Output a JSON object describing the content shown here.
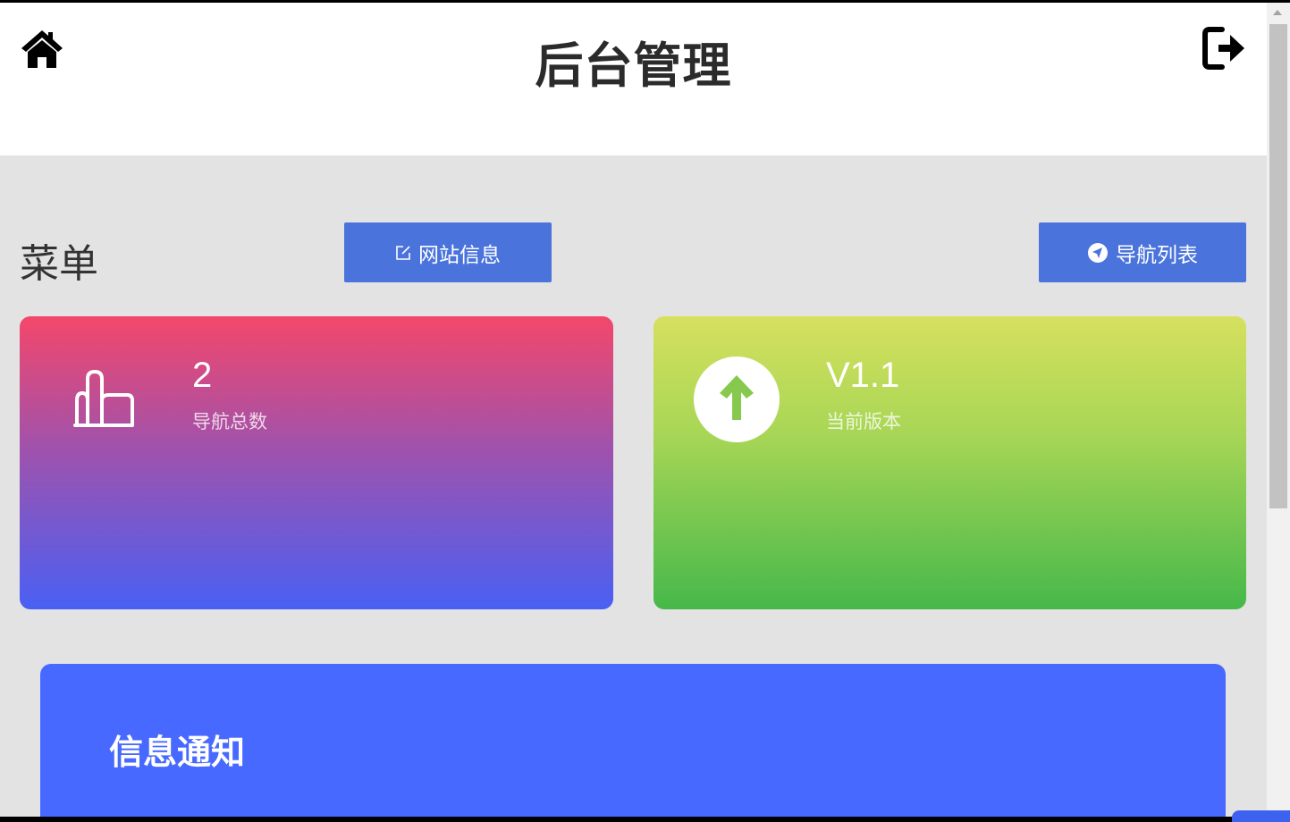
{
  "header": {
    "title": "后台管理",
    "home_icon": "home-icon",
    "logout_icon": "logout-icon"
  },
  "menu": {
    "title": "菜单",
    "site_info_button": "网站信息",
    "site_info_icon": "edit-icon",
    "nav_list_button": "导航列表",
    "nav_list_icon": "location-arrow-icon"
  },
  "stats": {
    "nav_total": {
      "value": "2",
      "label": "导航总数",
      "icon": "chart-bars-icon"
    },
    "version": {
      "value": "V1.1",
      "label": "当前版本",
      "icon": "arrow-up-circle-icon"
    }
  },
  "notice": {
    "title": "信息通知"
  },
  "colors": {
    "button": "#4a74dc",
    "notice": "#4769ff",
    "card_left_top": "#f4476a",
    "card_left_bottom": "#4960f4",
    "card_right_top": "#d6e05e",
    "card_right_bottom": "#46b84a"
  }
}
